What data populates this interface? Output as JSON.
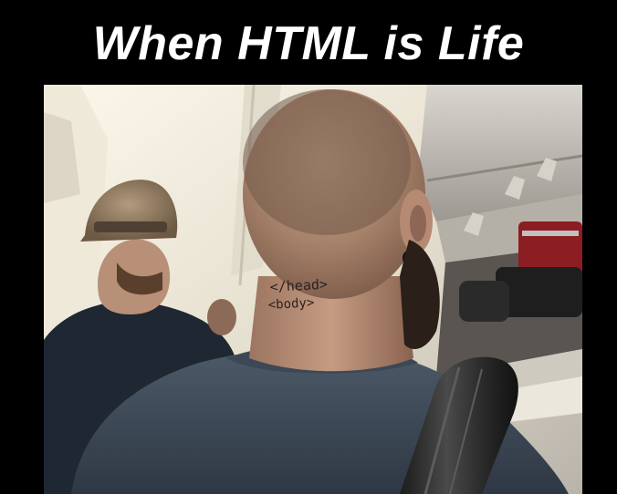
{
  "meme": {
    "caption": "When HTML is Life"
  },
  "photo": {
    "tattoo": {
      "line1": "</head>",
      "line2": "<body>"
    }
  }
}
